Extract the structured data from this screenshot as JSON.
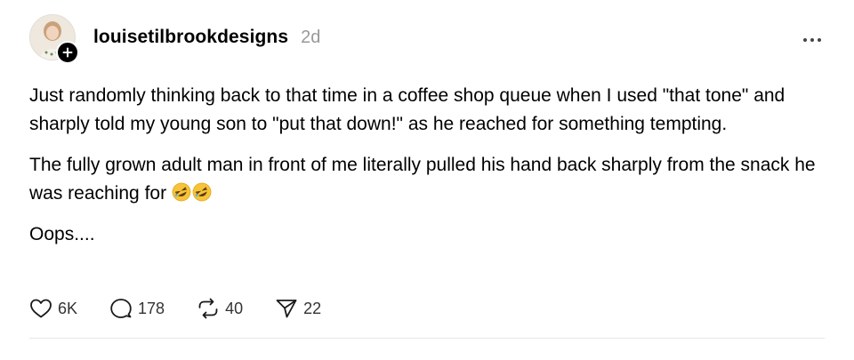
{
  "post": {
    "username": "louisetilbrookdesigns",
    "time": "2d",
    "paragraphs": [
      "Just randomly thinking back to that time in a coffee shop queue when I used \"that tone\" and sharply told my young son to \"put that down!\" as he reached for something tempting.",
      "The fully grown adult man in front of me literally pulled his hand back sharply from the snack he was reaching for",
      "Oops...."
    ],
    "emoji": "rolling-on-floor-laughing-emoji"
  },
  "actions": {
    "likes": "6K",
    "replies": "178",
    "reposts": "40",
    "shares": "22"
  },
  "icons": {
    "like": "heart-icon",
    "reply": "speech-bubble-icon",
    "repost": "repost-arrows-icon",
    "share": "send-icon",
    "more": "more-options-icon",
    "follow": "plus-icon"
  }
}
